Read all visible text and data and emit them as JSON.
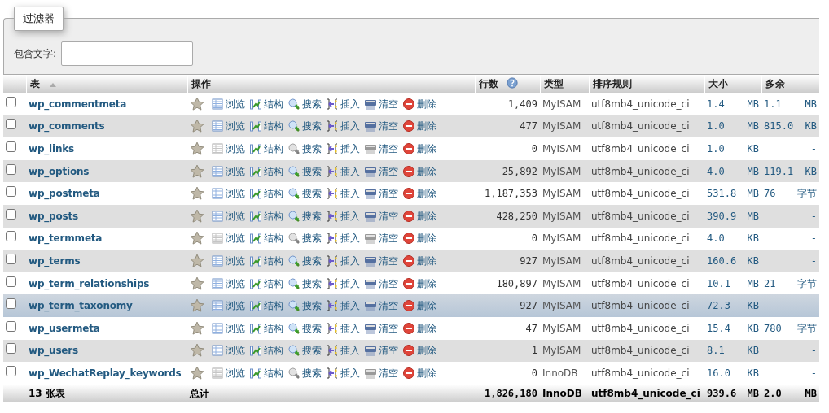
{
  "filter": {
    "legend": "过滤器",
    "label": "包含文字:"
  },
  "columns": [
    {
      "label": "表",
      "kind": "sort"
    },
    {
      "label": "操作",
      "kind": "plain"
    },
    {
      "label": "行数",
      "kind": "help"
    },
    {
      "label": "类型",
      "kind": "plain"
    },
    {
      "label": "排序规则",
      "kind": "plain"
    },
    {
      "label": "大小",
      "kind": "plain"
    },
    {
      "label": "多余",
      "kind": "plain"
    }
  ],
  "rows": [
    {
      "name": "wp_commentmeta",
      "checked": false,
      "highlighted": false,
      "actions": [
        {
          "kind": "browse",
          "label": "浏览",
          "disabled": false
        },
        {
          "kind": "structure",
          "label": "结构",
          "disabled": false
        },
        {
          "kind": "search",
          "label": "搜索",
          "disabled": false
        },
        {
          "kind": "insert",
          "label": "插入",
          "disabled": false
        },
        {
          "kind": "empty",
          "label": "清空",
          "disabled": false
        },
        {
          "kind": "drop",
          "label": "删除",
          "disabled": false
        }
      ],
      "rows": "1,409",
      "type": "MyISAM",
      "collation": "utf8mb4_unicode_ci",
      "size": "1.4",
      "size_unit": "MB",
      "overhead": "1.1",
      "overhead_unit": "MB"
    },
    {
      "name": "wp_comments",
      "checked": false,
      "highlighted": false,
      "actions": [
        {
          "kind": "browse",
          "label": "浏览",
          "disabled": false
        },
        {
          "kind": "structure",
          "label": "结构",
          "disabled": false
        },
        {
          "kind": "search",
          "label": "搜索",
          "disabled": false
        },
        {
          "kind": "insert",
          "label": "插入",
          "disabled": false
        },
        {
          "kind": "empty",
          "label": "清空",
          "disabled": false
        },
        {
          "kind": "drop",
          "label": "删除",
          "disabled": false
        }
      ],
      "rows": "477",
      "type": "MyISAM",
      "collation": "utf8mb4_unicode_ci",
      "size": "1.0",
      "size_unit": "MB",
      "overhead": "815.0",
      "overhead_unit": "KB"
    },
    {
      "name": "wp_links",
      "checked": false,
      "highlighted": false,
      "actions": [
        {
          "kind": "browse",
          "label": "浏览",
          "disabled": true
        },
        {
          "kind": "structure",
          "label": "结构",
          "disabled": false
        },
        {
          "kind": "search",
          "label": "搜索",
          "disabled": true
        },
        {
          "kind": "insert",
          "label": "插入",
          "disabled": false
        },
        {
          "kind": "empty",
          "label": "清空",
          "disabled": true
        },
        {
          "kind": "drop",
          "label": "删除",
          "disabled": false
        }
      ],
      "rows": "0",
      "type": "MyISAM",
      "collation": "utf8mb4_unicode_ci",
      "size": "1.0",
      "size_unit": "KB",
      "overhead": "-"
    },
    {
      "name": "wp_options",
      "checked": false,
      "highlighted": false,
      "actions": [
        {
          "kind": "browse",
          "label": "浏览",
          "disabled": false
        },
        {
          "kind": "structure",
          "label": "结构",
          "disabled": false
        },
        {
          "kind": "search",
          "label": "搜索",
          "disabled": false
        },
        {
          "kind": "insert",
          "label": "插入",
          "disabled": false
        },
        {
          "kind": "empty",
          "label": "清空",
          "disabled": false
        },
        {
          "kind": "drop",
          "label": "删除",
          "disabled": false
        }
      ],
      "rows": "25,892",
      "type": "MyISAM",
      "collation": "utf8mb4_unicode_ci",
      "size": "4.0",
      "size_unit": "MB",
      "overhead": "119.1",
      "overhead_unit": "KB"
    },
    {
      "name": "wp_postmeta",
      "checked": false,
      "highlighted": false,
      "actions": [
        {
          "kind": "browse",
          "label": "浏览",
          "disabled": false
        },
        {
          "kind": "structure",
          "label": "结构",
          "disabled": false
        },
        {
          "kind": "search",
          "label": "搜索",
          "disabled": false
        },
        {
          "kind": "insert",
          "label": "插入",
          "disabled": false
        },
        {
          "kind": "empty",
          "label": "清空",
          "disabled": false
        },
        {
          "kind": "drop",
          "label": "删除",
          "disabled": false
        }
      ],
      "rows": "1,187,353",
      "type": "MyISAM",
      "collation": "utf8mb4_unicode_ci",
      "size": "531.8",
      "size_unit": "MB",
      "overhead": "76",
      "overhead_unit": "字节"
    },
    {
      "name": "wp_posts",
      "checked": false,
      "highlighted": false,
      "actions": [
        {
          "kind": "browse",
          "label": "浏览",
          "disabled": false
        },
        {
          "kind": "structure",
          "label": "结构",
          "disabled": false
        },
        {
          "kind": "search",
          "label": "搜索",
          "disabled": false
        },
        {
          "kind": "insert",
          "label": "插入",
          "disabled": false
        },
        {
          "kind": "empty",
          "label": "清空",
          "disabled": false
        },
        {
          "kind": "drop",
          "label": "删除",
          "disabled": false
        }
      ],
      "rows": "428,250",
      "type": "MyISAM",
      "collation": "utf8mb4_unicode_ci",
      "size": "390.9",
      "size_unit": "MB",
      "overhead": "-"
    },
    {
      "name": "wp_termmeta",
      "checked": false,
      "highlighted": false,
      "actions": [
        {
          "kind": "browse",
          "label": "浏览",
          "disabled": true
        },
        {
          "kind": "structure",
          "label": "结构",
          "disabled": false
        },
        {
          "kind": "search",
          "label": "搜索",
          "disabled": true
        },
        {
          "kind": "insert",
          "label": "插入",
          "disabled": false
        },
        {
          "kind": "empty",
          "label": "清空",
          "disabled": true
        },
        {
          "kind": "drop",
          "label": "删除",
          "disabled": false
        }
      ],
      "rows": "0",
      "type": "MyISAM",
      "collation": "utf8mb4_unicode_ci",
      "size": "4.0",
      "size_unit": "KB",
      "overhead": "-"
    },
    {
      "name": "wp_terms",
      "checked": false,
      "highlighted": false,
      "actions": [
        {
          "kind": "browse",
          "label": "浏览",
          "disabled": false
        },
        {
          "kind": "structure",
          "label": "结构",
          "disabled": false
        },
        {
          "kind": "search",
          "label": "搜索",
          "disabled": false
        },
        {
          "kind": "insert",
          "label": "插入",
          "disabled": false
        },
        {
          "kind": "empty",
          "label": "清空",
          "disabled": false
        },
        {
          "kind": "drop",
          "label": "删除",
          "disabled": false
        }
      ],
      "rows": "927",
      "type": "MyISAM",
      "collation": "utf8mb4_unicode_ci",
      "size": "160.6",
      "size_unit": "KB",
      "overhead": "-"
    },
    {
      "name": "wp_term_relationships",
      "checked": false,
      "highlighted": false,
      "actions": [
        {
          "kind": "browse",
          "label": "浏览",
          "disabled": false
        },
        {
          "kind": "structure",
          "label": "结构",
          "disabled": false
        },
        {
          "kind": "search",
          "label": "搜索",
          "disabled": false
        },
        {
          "kind": "insert",
          "label": "插入",
          "disabled": false
        },
        {
          "kind": "empty",
          "label": "清空",
          "disabled": false
        },
        {
          "kind": "drop",
          "label": "删除",
          "disabled": false
        }
      ],
      "rows": "180,897",
      "type": "MyISAM",
      "collation": "utf8mb4_unicode_ci",
      "size": "10.1",
      "size_unit": "MB",
      "overhead": "21",
      "overhead_unit": "字节"
    },
    {
      "name": "wp_term_taxonomy",
      "checked": false,
      "highlighted": true,
      "actions": [
        {
          "kind": "browse",
          "label": "浏览",
          "disabled": false
        },
        {
          "kind": "structure",
          "label": "结构",
          "disabled": false
        },
        {
          "kind": "search",
          "label": "搜索",
          "disabled": false
        },
        {
          "kind": "insert",
          "label": "插入",
          "disabled": false
        },
        {
          "kind": "empty",
          "label": "清空",
          "disabled": false
        },
        {
          "kind": "drop",
          "label": "删除",
          "disabled": false
        }
      ],
      "rows": "927",
      "type": "MyISAM",
      "collation": "utf8mb4_unicode_ci",
      "size": "72.3",
      "size_unit": "KB",
      "overhead": "-"
    },
    {
      "name": "wp_usermeta",
      "checked": false,
      "highlighted": false,
      "actions": [
        {
          "kind": "browse",
          "label": "浏览",
          "disabled": false
        },
        {
          "kind": "structure",
          "label": "结构",
          "disabled": false
        },
        {
          "kind": "search",
          "label": "搜索",
          "disabled": false
        },
        {
          "kind": "insert",
          "label": "插入",
          "disabled": false
        },
        {
          "kind": "empty",
          "label": "清空",
          "disabled": false
        },
        {
          "kind": "drop",
          "label": "删除",
          "disabled": false
        }
      ],
      "rows": "47",
      "type": "MyISAM",
      "collation": "utf8mb4_unicode_ci",
      "size": "15.4",
      "size_unit": "KB",
      "overhead": "780",
      "overhead_unit": "字节"
    },
    {
      "name": "wp_users",
      "checked": false,
      "highlighted": false,
      "actions": [
        {
          "kind": "browse",
          "label": "浏览",
          "disabled": false
        },
        {
          "kind": "structure",
          "label": "结构",
          "disabled": false
        },
        {
          "kind": "search",
          "label": "搜索",
          "disabled": false
        },
        {
          "kind": "insert",
          "label": "插入",
          "disabled": false
        },
        {
          "kind": "empty",
          "label": "清空",
          "disabled": false
        },
        {
          "kind": "drop",
          "label": "删除",
          "disabled": false
        }
      ],
      "rows": "1",
      "type": "MyISAM",
      "collation": "utf8mb4_unicode_ci",
      "size": "8.1",
      "size_unit": "KB",
      "overhead": "-"
    },
    {
      "name": "wp_WechatReplay_keywords",
      "checked": false,
      "highlighted": false,
      "actions": [
        {
          "kind": "browse",
          "label": "浏览",
          "disabled": true
        },
        {
          "kind": "structure",
          "label": "结构",
          "disabled": false
        },
        {
          "kind": "search",
          "label": "搜索",
          "disabled": true
        },
        {
          "kind": "insert",
          "label": "插入",
          "disabled": false
        },
        {
          "kind": "empty",
          "label": "清空",
          "disabled": true
        },
        {
          "kind": "drop",
          "label": "删除",
          "disabled": false
        }
      ],
      "rows": "0",
      "type": "InnoDB",
      "collation": "utf8mb4_unicode_ci",
      "size": "16.0",
      "size_unit": "KB",
      "overhead": "-"
    }
  ],
  "footer": {
    "count": "13 张表",
    "label": "总计",
    "rows": "1,826,180",
    "type": "InnoDB",
    "collation": "utf8mb4_unicode_ci",
    "size": "939.6",
    "size_unit": "MB",
    "overhead": "2.0",
    "overhead_unit": "MB"
  }
}
